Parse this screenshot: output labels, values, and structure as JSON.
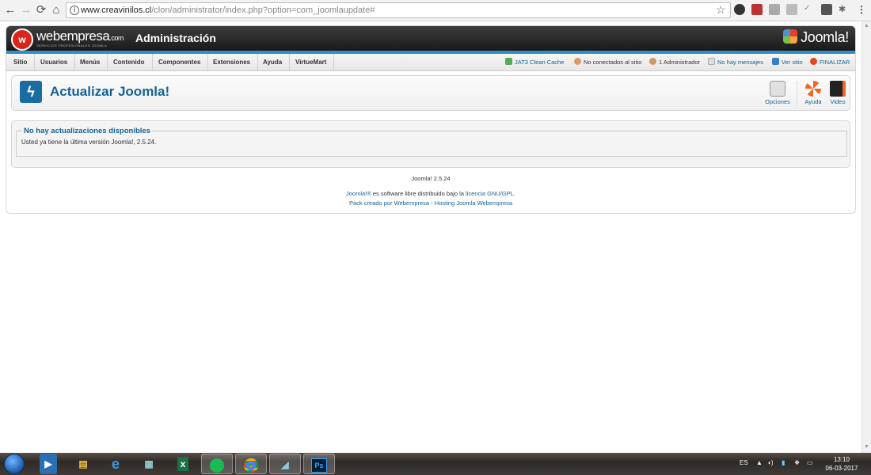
{
  "browser": {
    "url_host": "www.creavinilos.cl",
    "url_path": "/clon/administrator/index.php?option=com_joomlaupdate#"
  },
  "header": {
    "brand_name": "webempresa",
    "brand_suffix": ".com",
    "brand_tagline": "SERVICIOS PROFESIONALES JOOMLA",
    "title": "Administración",
    "product_brand": "Joomla!"
  },
  "menu": {
    "items": [
      {
        "label": "Sitio"
      },
      {
        "label": "Usuarios"
      },
      {
        "label": "Menús"
      },
      {
        "label": "Contenido"
      },
      {
        "label": "Componentes"
      },
      {
        "label": "Extensiones"
      },
      {
        "label": "Ayuda"
      },
      {
        "label": "VirtueMart"
      }
    ],
    "status": {
      "cache": "JAT3 Clean Cache",
      "site_users": "No conectados al sitio",
      "admins": "1 Administrador",
      "messages": "No hay mensajes",
      "view_site": "Ver sitio",
      "logout": "FINALIZAR"
    }
  },
  "toolbar": {
    "title": "Actualizar Joomla!",
    "options_label": "Opciones",
    "help_label": "Ayuda",
    "video_label": "Video"
  },
  "message": {
    "legend": "No hay actualizaciones disponibles",
    "text": "Usted ya tiene la última versión Joomla!, 2.5.24."
  },
  "footer": {
    "version": "Joomla! 2.5.24",
    "license_link": "Joomla!®",
    "license_text": "es software libre distribuido bajo la",
    "license_link2": "licencia GNU/GPL.",
    "pack_text": "Pack creado por Webempresa",
    "pack_sep": "-",
    "hosting_text": "Hosting Joomla Webempresa"
  },
  "taskbar": {
    "language": "ES",
    "time": "13:10",
    "date": "06-03-2017"
  }
}
